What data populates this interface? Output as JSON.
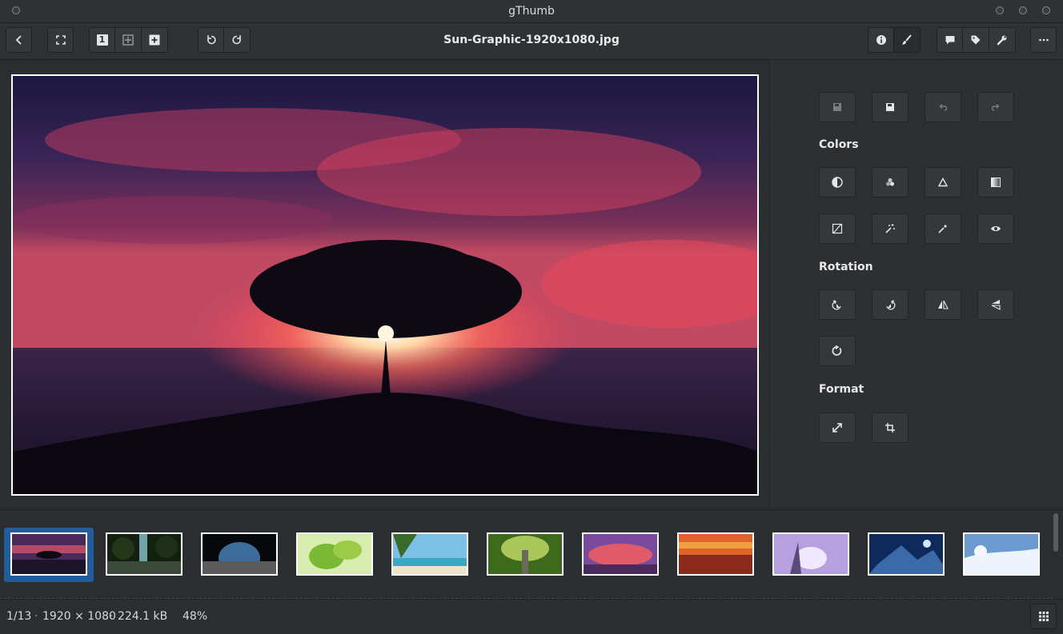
{
  "window": {
    "title": "gThumb"
  },
  "toolbar": {
    "file_title": "Sun-Graphic-1920x1080.jpg",
    "buttons": {
      "back": "back-icon",
      "fullscreen": "fullscreen-icon",
      "zoom_actual": "1",
      "zoom_fit": "zoom-fit-icon",
      "zoom_in": "zoom-plus-icon",
      "rotate_left": "rotate-left-icon",
      "rotate_right": "rotate-right-icon",
      "properties": "info-icon",
      "edit": "brush-icon",
      "comment": "comment-icon",
      "tags": "tag-icon",
      "tools": "wrench-icon",
      "more": "more-icon"
    }
  },
  "sidebar": {
    "sections": {
      "colors": "Colors",
      "rotation": "Rotation",
      "format": "Format"
    }
  },
  "statusbar": {
    "position": "1/13",
    "dimensions": "1920 × 1080",
    "size": "224.1 kB",
    "zoom": "48%"
  },
  "colors": {
    "accent": "#215d9c",
    "background": "#2b2e31"
  }
}
